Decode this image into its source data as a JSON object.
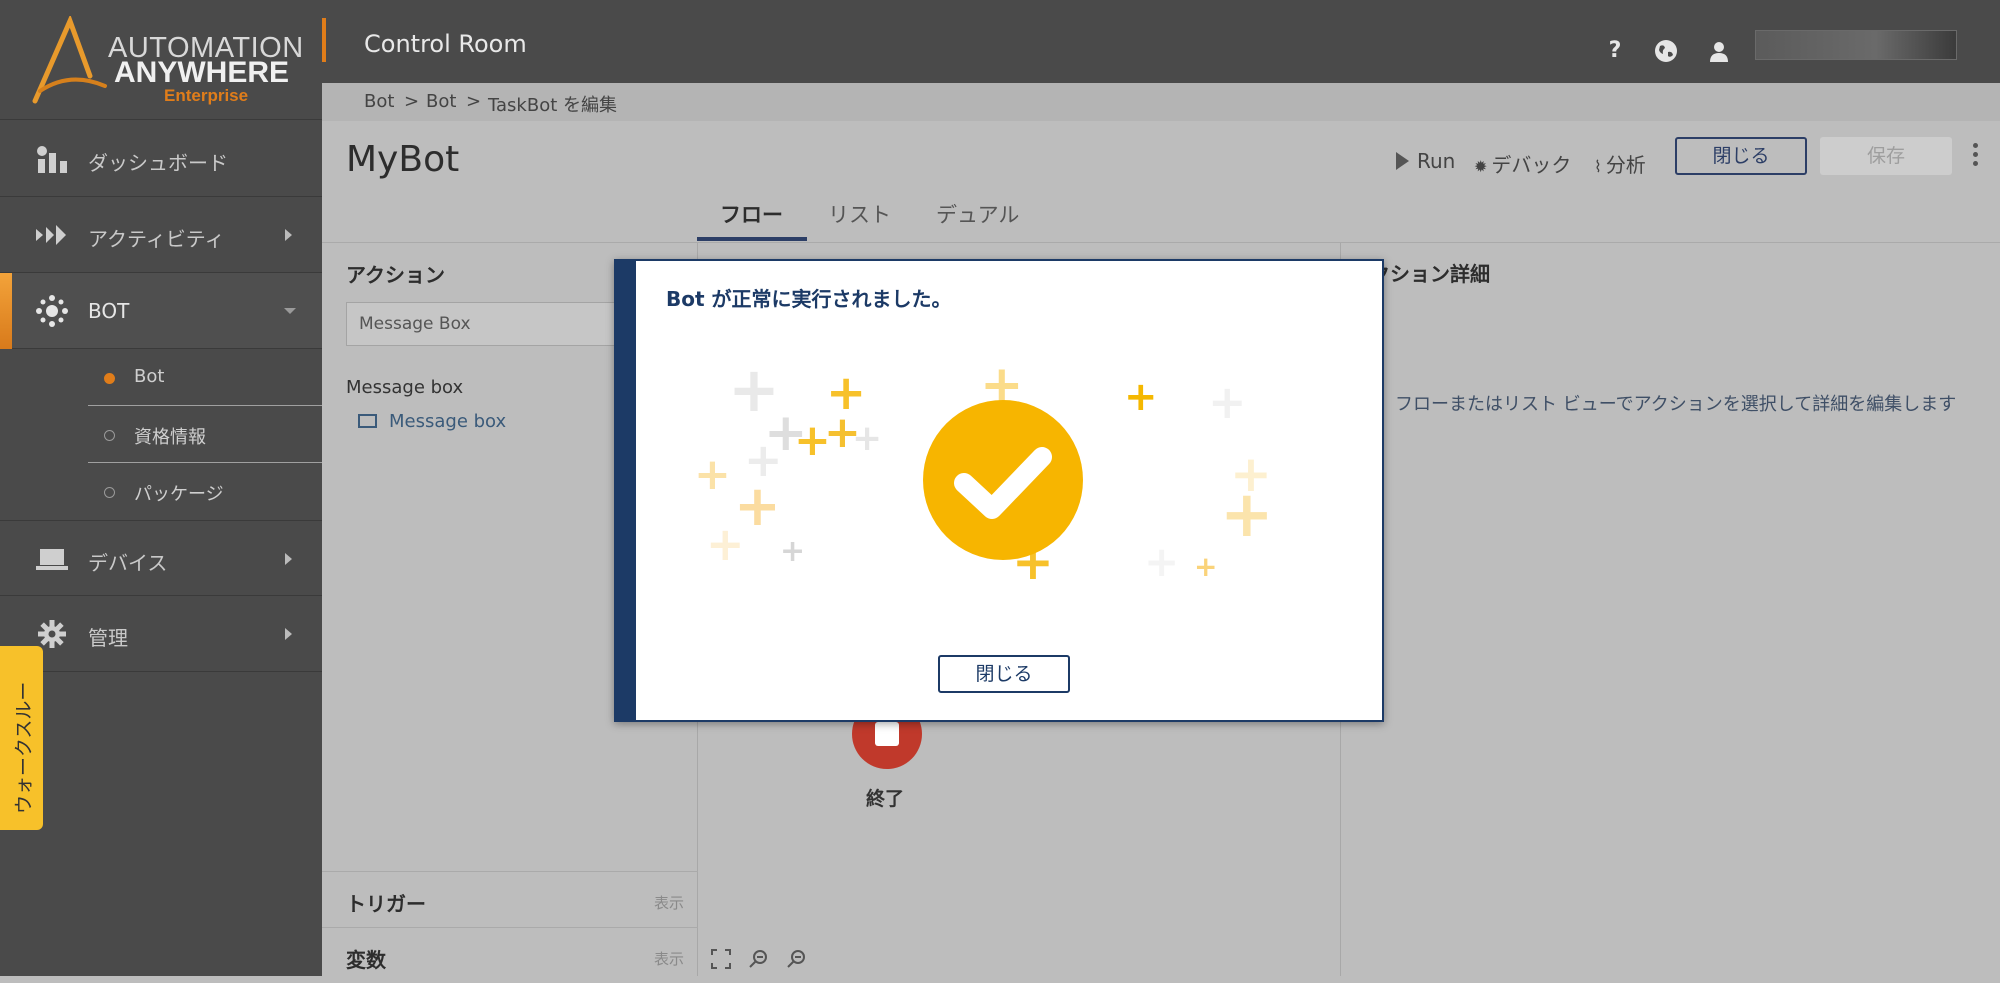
{
  "sidebar": {
    "logo": {
      "line1": "AUTOMATION",
      "line2": "ANYWHERE",
      "line3": "Enterprise"
    },
    "items": [
      {
        "label": "ダッシュボード",
        "icon": "dashboard-icon"
      },
      {
        "label": "アクティビティ",
        "icon": "activity-icon"
      },
      {
        "label": "BOT",
        "icon": "bot-icon"
      },
      {
        "label": "デバイス",
        "icon": "laptop-icon"
      },
      {
        "label": "管理",
        "icon": "gear-icon"
      }
    ],
    "sub_items": [
      {
        "label": "Bot",
        "selected": true
      },
      {
        "label": "資格情報",
        "selected": false
      },
      {
        "label": "パッケージ",
        "selected": false
      }
    ],
    "walkthrough": "ウォークスルー"
  },
  "topbar": {
    "title": "Control Room",
    "help": "?",
    "user_name": ""
  },
  "breadcrumb": {
    "item1": "Bot",
    "sep": ">",
    "item2": "Bot",
    "item3": "TaskBot を編集"
  },
  "header": {
    "title": "MyBot",
    "run_label": "Run",
    "debug_label": "デバック",
    "analyze_label": "分析",
    "close_label": "閉じる",
    "save_label": "保存",
    "tabs": [
      {
        "label": "フロー",
        "active": true
      },
      {
        "label": "リスト",
        "active": false
      },
      {
        "label": "デュアル",
        "active": false
      }
    ]
  },
  "left_panel": {
    "actions_title": "アクション",
    "search_value": "Message Box",
    "group_label": "Message box",
    "item_label": "Message box",
    "trigger_title": "トリガー",
    "trigger_show": "表示",
    "variables_title": "変数",
    "variables_show": "表示"
  },
  "canvas": {
    "end_label": "終了"
  },
  "right_panel": {
    "title": "クション詳細",
    "hint": "フローまたはリスト ビューでアクションを選択して詳細を編集します"
  },
  "modal": {
    "message": "Bot が正常に実行されました。",
    "close_label": "閉じる",
    "success_icon": "checkmark-circle-icon"
  },
  "colors": {
    "accent_orange": "#e07d1a",
    "navy": "#1c3a66",
    "success_yellow": "#f7b500",
    "stop_red": "#c0392b"
  }
}
